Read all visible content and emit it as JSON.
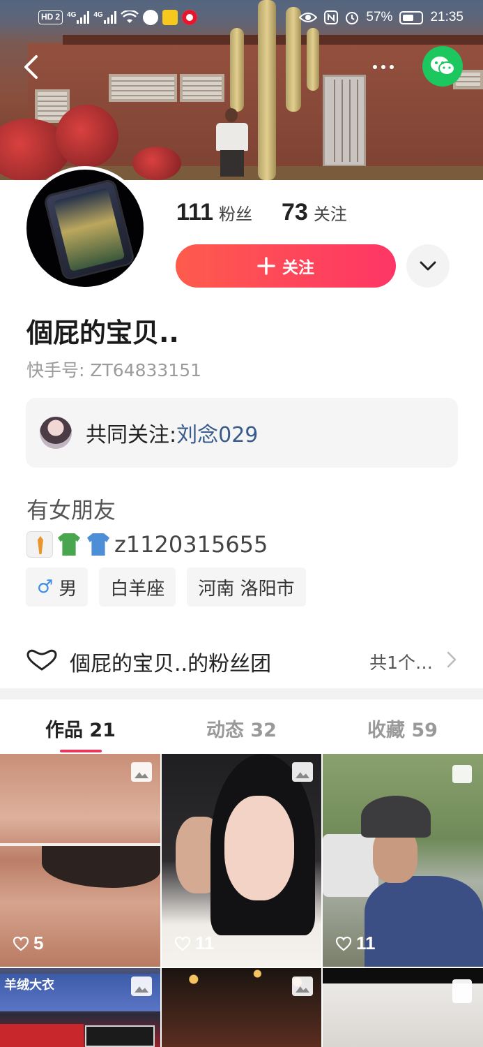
{
  "status_bar": {
    "left_chip": "HD",
    "left_chip_num": "2",
    "network1": "4G",
    "network2": "4G",
    "battery_percent": "57%",
    "time": "21:35"
  },
  "header": {
    "back_icon": "chevron-left-icon",
    "more_icon": "more-dots-icon",
    "share_icon": "wechat-icon",
    "share_color": "#1dc760"
  },
  "profile": {
    "followers_count": "111",
    "followers_label": "粉丝",
    "following_count": "73",
    "following_label": "关注",
    "follow_button_label": "关注",
    "follow_button_color": "#fe4a5a",
    "name": "個屁的宝贝..",
    "kuaishou_id": "快手号: ZT64833151",
    "mutual_label": "共同关注: ",
    "mutual_user": "刘念029",
    "bio_line1": "有女朋友",
    "bio_line2_text": "z1120315655",
    "bio_emojis": [
      "necktie-shirt-icon",
      "tshirt-icon",
      "shirt-icon"
    ],
    "tags": [
      {
        "icon": "male-icon",
        "symbol": "♂",
        "label": "男"
      },
      {
        "label": "白羊座"
      },
      {
        "label": "河南 洛阳市"
      }
    ]
  },
  "fanclub": {
    "icon": "heart-outline-icon",
    "title": "個屁的宝贝..的粉丝团",
    "count_text": "共1个…"
  },
  "tabs": [
    {
      "label": "作品 21",
      "active": true
    },
    {
      "label": "动态 32",
      "active": false
    },
    {
      "label": "收藏 59",
      "active": false
    }
  ],
  "grid": {
    "items": [
      {
        "likes": "5",
        "type": "image"
      },
      {
        "likes": "11",
        "type": "image"
      },
      {
        "likes": "11",
        "type": "plain"
      },
      {
        "type": "image",
        "sign_text": "羊绒大衣"
      },
      {
        "type": "image"
      },
      {
        "type": "plain"
      }
    ]
  }
}
